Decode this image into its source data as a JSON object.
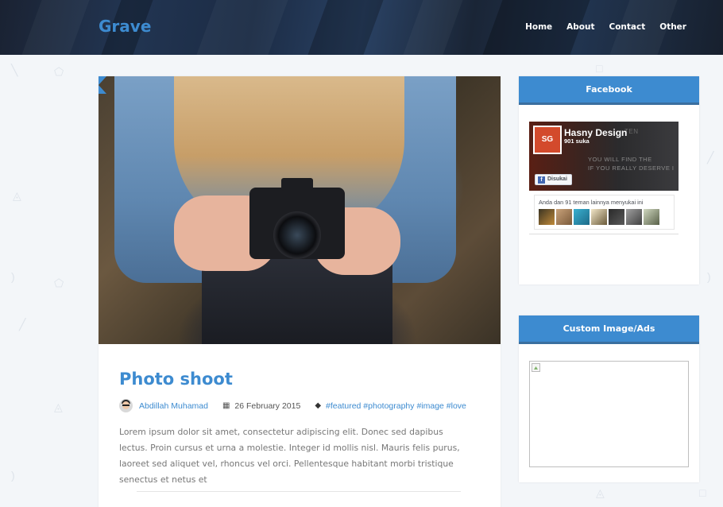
{
  "header": {
    "brand": "Grave",
    "nav": [
      "Home",
      "About",
      "Contact",
      "Other"
    ]
  },
  "post": {
    "title": "Photo shoot",
    "author": "Abdillah Muhamad",
    "date": "26 February 2015",
    "tags": "#featured #photography #image #love",
    "excerpt": "Lorem ipsum dolor sit amet, consectetur adipiscing elit. Donec sed dapibus lectus. Proin cursus et urna a molestie. Integer id mollis nisl. Mauris felis purus, laoreet sed aliquet vel, rhoncus vel orci. Pellentesque habitant morbi tristique senectus et netus et"
  },
  "sidebar": {
    "facebook": {
      "title": "Facebook",
      "page_name": "Hasny Design",
      "likes": "901 suka",
      "like_button": "Disukai",
      "friends_text": "Anda dan 91 teman lainnya menyukai ini",
      "cover_text_line1": "YOU WILL FIND THE",
      "cover_text_line2": "IF YOU REALLY DESERVE I",
      "cover_faint": "TEN"
    },
    "ads": {
      "title": "Custom Image/Ads"
    }
  },
  "colors": {
    "accent": "#3d8bd0",
    "header_bg": "#1b2b44",
    "page_bg": "#f3f6f9"
  },
  "icons": {
    "calendar": "calendar-icon",
    "tag": "tag-icon",
    "broken_image": "broken-image-icon"
  }
}
